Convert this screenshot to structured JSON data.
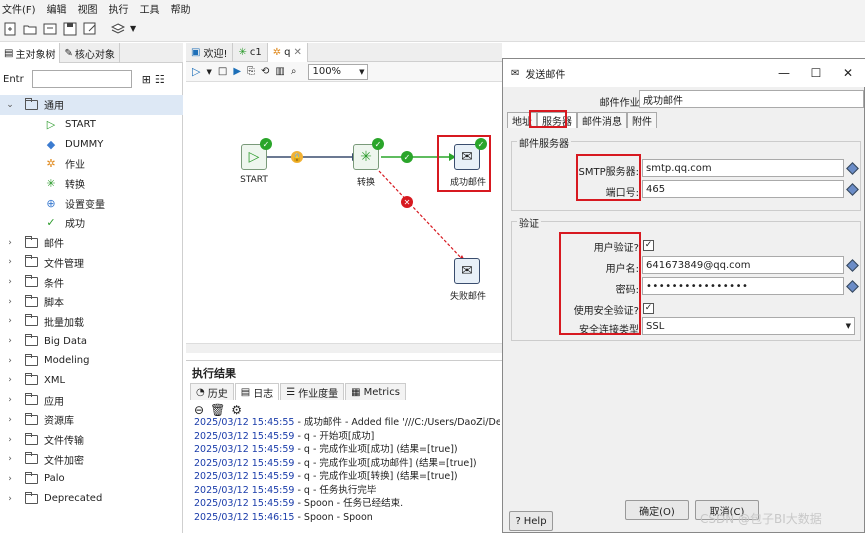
{
  "menu": [
    "文件(F)",
    "编辑",
    "视图",
    "执行",
    "工具",
    "帮助"
  ],
  "left_panel": {
    "tabs": [
      "主对象树",
      "核心对象"
    ],
    "search_label": "Entr",
    "search_value": "",
    "tree": {
      "group": "通用",
      "children": [
        "START",
        "DUMMY",
        "作业",
        "转换",
        "设置变量",
        "成功"
      ],
      "folders": [
        "邮件",
        "文件管理",
        "条件",
        "脚本",
        "批量加载",
        "Big Data",
        "Modeling",
        "XML",
        "应用",
        "资源库",
        "文件传输",
        "文件加密",
        "Palo",
        "Deprecated"
      ]
    }
  },
  "editor": {
    "tabs": [
      "欢迎!",
      "c1",
      "q"
    ],
    "zoom": "100%",
    "nodes": {
      "start": "START",
      "transform": "转换",
      "success_mail": "成功邮件",
      "fail_mail": "失败邮件"
    }
  },
  "results": {
    "title": "执行结果",
    "tabs": [
      "历史",
      "日志",
      "作业度量",
      "Metrics"
    ],
    "log": [
      {
        "ts": "2025/03/12 15:45:55",
        "msg": " - 成功邮件 - Added file '///C:/Users/DaoZi/Desk"
      },
      {
        "ts": "2025/03/12 15:45:59",
        "msg": " - q - 开始项[成功]"
      },
      {
        "ts": "2025/03/12 15:45:59",
        "msg": " - q - 完成作业项[成功] (结果=[true])"
      },
      {
        "ts": "2025/03/12 15:45:59",
        "msg": " - q - 完成作业项[成功邮件] (结果=[true])"
      },
      {
        "ts": "2025/03/12 15:45:59",
        "msg": " - q - 完成作业项[转换] (结果=[true])"
      },
      {
        "ts": "2025/03/12 15:45:59",
        "msg": " - q - 任务执行完毕"
      },
      {
        "ts": "2025/03/12 15:45:59",
        "msg": " - Spoon - 任务已经结束."
      },
      {
        "ts": "2025/03/12 15:46:15",
        "msg": " - Spoon - Spoon"
      }
    ]
  },
  "dialog": {
    "title": "发送邮件",
    "job_name_label": "邮件作业名称:",
    "job_name_value": "成功邮件",
    "tabs": [
      "地址",
      "服务器",
      "邮件消息",
      "附件"
    ],
    "server_group": "邮件服务器",
    "smtp_label": "SMTP服务器:",
    "smtp_value": "smtp.qq.com",
    "port_label": "端口号:",
    "port_value": "465",
    "auth_group": "验证",
    "user_auth_label": "用户验证?",
    "user_auth_checked": true,
    "username_label": "用户名:",
    "username_value": "641673849@qq.com",
    "password_label": "密码:",
    "password_value": "••••••••••••••••",
    "secure_auth_label": "使用安全验证?",
    "secure_auth_checked": true,
    "secure_conn_label": "安全连接类型",
    "secure_conn_value": "SSL",
    "help_button": "Help",
    "ok_button": "确定(O)",
    "cancel_button": "取消(C)"
  },
  "watermark": "CSDN @包子BI大数据",
  "colors": {
    "highlight": "#d71920",
    "ok": "#2aa52a",
    "log_ts": "#1a3caa"
  }
}
